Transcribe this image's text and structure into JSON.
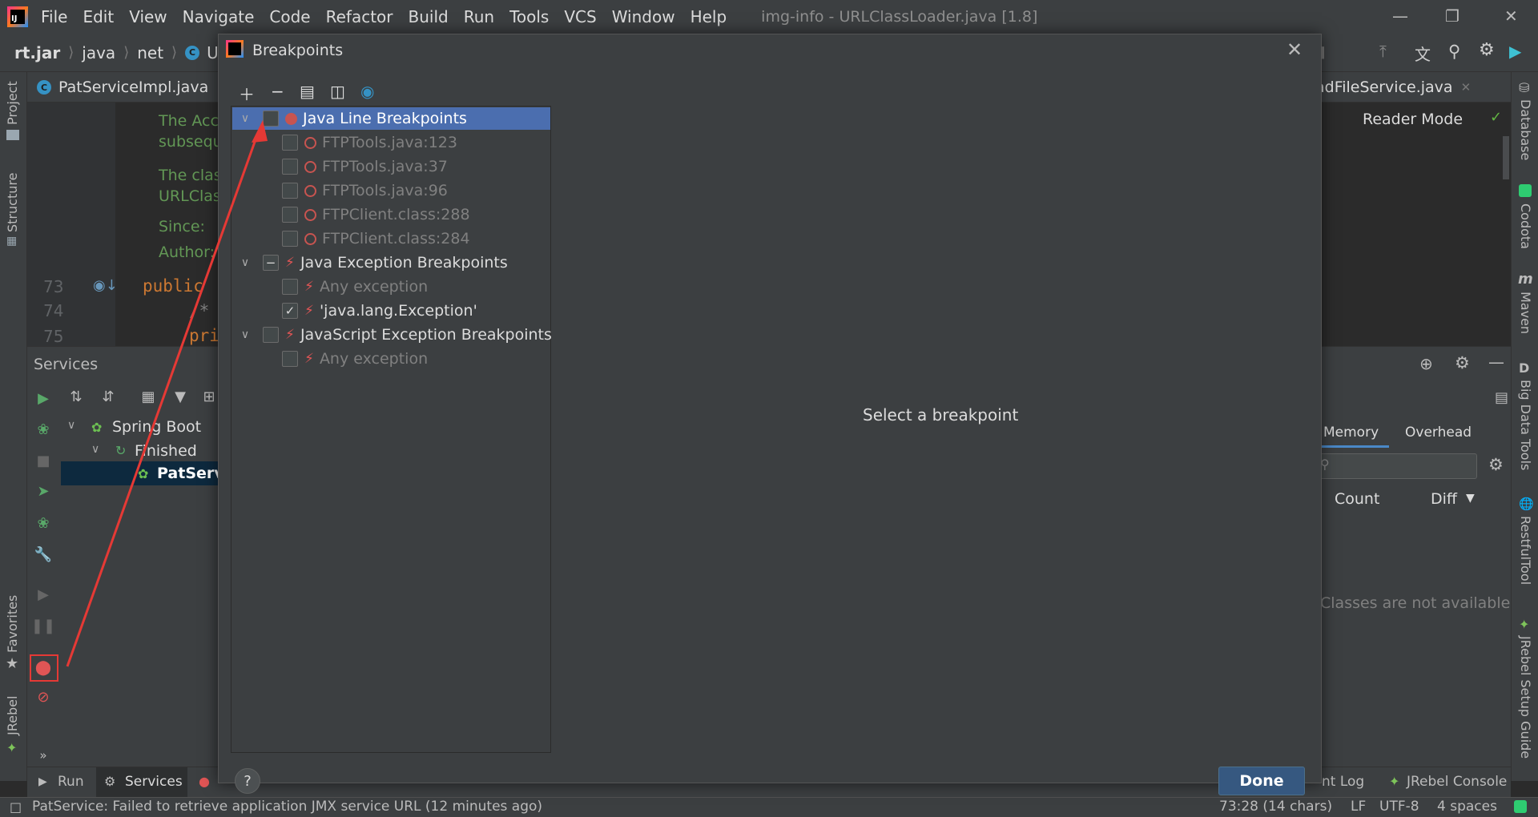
{
  "titlebar": {
    "menu": [
      "File",
      "Edit",
      "View",
      "Navigate",
      "Code",
      "Refactor",
      "Build",
      "Run",
      "Tools",
      "VCS",
      "Window",
      "Help"
    ],
    "window_title": "img-info - URLClassLoader.java [1.8]"
  },
  "navbar": {
    "crumbs": [
      "rt.jar",
      "java",
      "net",
      "URLC"
    ]
  },
  "tabs": {
    "left": "PatServiceImpl.java",
    "right": "adFileService.java"
  },
  "left_stripe": {
    "project": "Project",
    "structure": "Structure",
    "favorites": "Favorites",
    "jrebel": "JRebel"
  },
  "right_stripe": {
    "database": "Database",
    "codota": "Codota",
    "maven": "Maven",
    "big_data": "Big Data Tools",
    "restful": "RestfulTool",
    "jrebel_guide": "JRebel Setup Guide"
  },
  "editor": {
    "doc_lines": [
      "The Acc",
      "subsequ",
      "The clas",
      "URLClas",
      "Since:",
      "Author:"
    ],
    "line_numbers": [
      "73",
      "74",
      "75"
    ],
    "code": [
      "public",
      "/*",
      "pri"
    ],
    "reader_mode": "Reader Mode"
  },
  "services": {
    "title": "Services",
    "tree": {
      "root": "Spring Boot",
      "child": "Finished",
      "leaf": "PatServi"
    },
    "right_tabs": {
      "memory": "Memory",
      "overhead": "Overhead"
    },
    "columns": {
      "count": "Count",
      "diff": "Diff"
    },
    "empty": "Classes are not available"
  },
  "bottom_tabs": {
    "run": "Run",
    "services": "Services",
    "event_log": "nt Log",
    "jrebel_console": "JRebel Console"
  },
  "statusbar": {
    "message": "PatService: Failed to retrieve application JMX service URL (12 minutes ago)",
    "position": "73:28 (14 chars)",
    "line_sep": "LF",
    "encoding": "UTF-8",
    "indent": "4 spaces"
  },
  "dialog": {
    "title": "Breakpoints",
    "select_message": "Select a breakpoint",
    "done_label": "Done",
    "help_label": "?",
    "groups": [
      {
        "label": "Java Line Breakpoints",
        "items": [
          "FTPTools.java:123",
          "FTPTools.java:37",
          "FTPTools.java:96",
          "FTPClient.class:288",
          "FTPClient.class:284"
        ]
      },
      {
        "label": "Java Exception Breakpoints",
        "items": [
          "Any exception",
          "'java.lang.Exception'"
        ]
      },
      {
        "label": "JavaScript Exception Breakpoints",
        "items": [
          "Any exception"
        ]
      }
    ]
  }
}
